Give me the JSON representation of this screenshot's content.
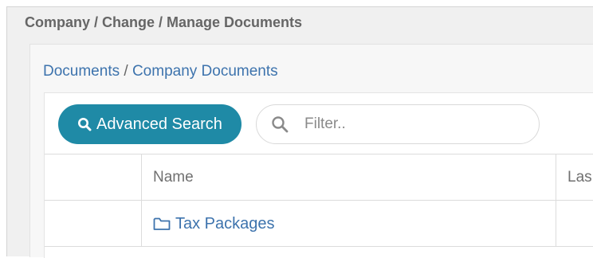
{
  "header": {
    "title": "Company / Change / Manage Documents"
  },
  "breadcrumb": {
    "items": [
      "Documents",
      "Company Documents"
    ],
    "separator": " / "
  },
  "toolbar": {
    "advanced_search_label": "Advanced Search",
    "advanced_search_icon": "search-icon",
    "filter_placeholder": "Filter..",
    "filter_value": "",
    "filter_icon": "search-icon"
  },
  "table": {
    "columns": [
      "",
      "Name",
      "Las"
    ],
    "rows": [
      {
        "name": "Tax Packages",
        "icon": "folder-icon"
      }
    ]
  },
  "colors": {
    "accent": "#1f8aa6",
    "link": "#3d73ad",
    "title_text": "#666666"
  }
}
